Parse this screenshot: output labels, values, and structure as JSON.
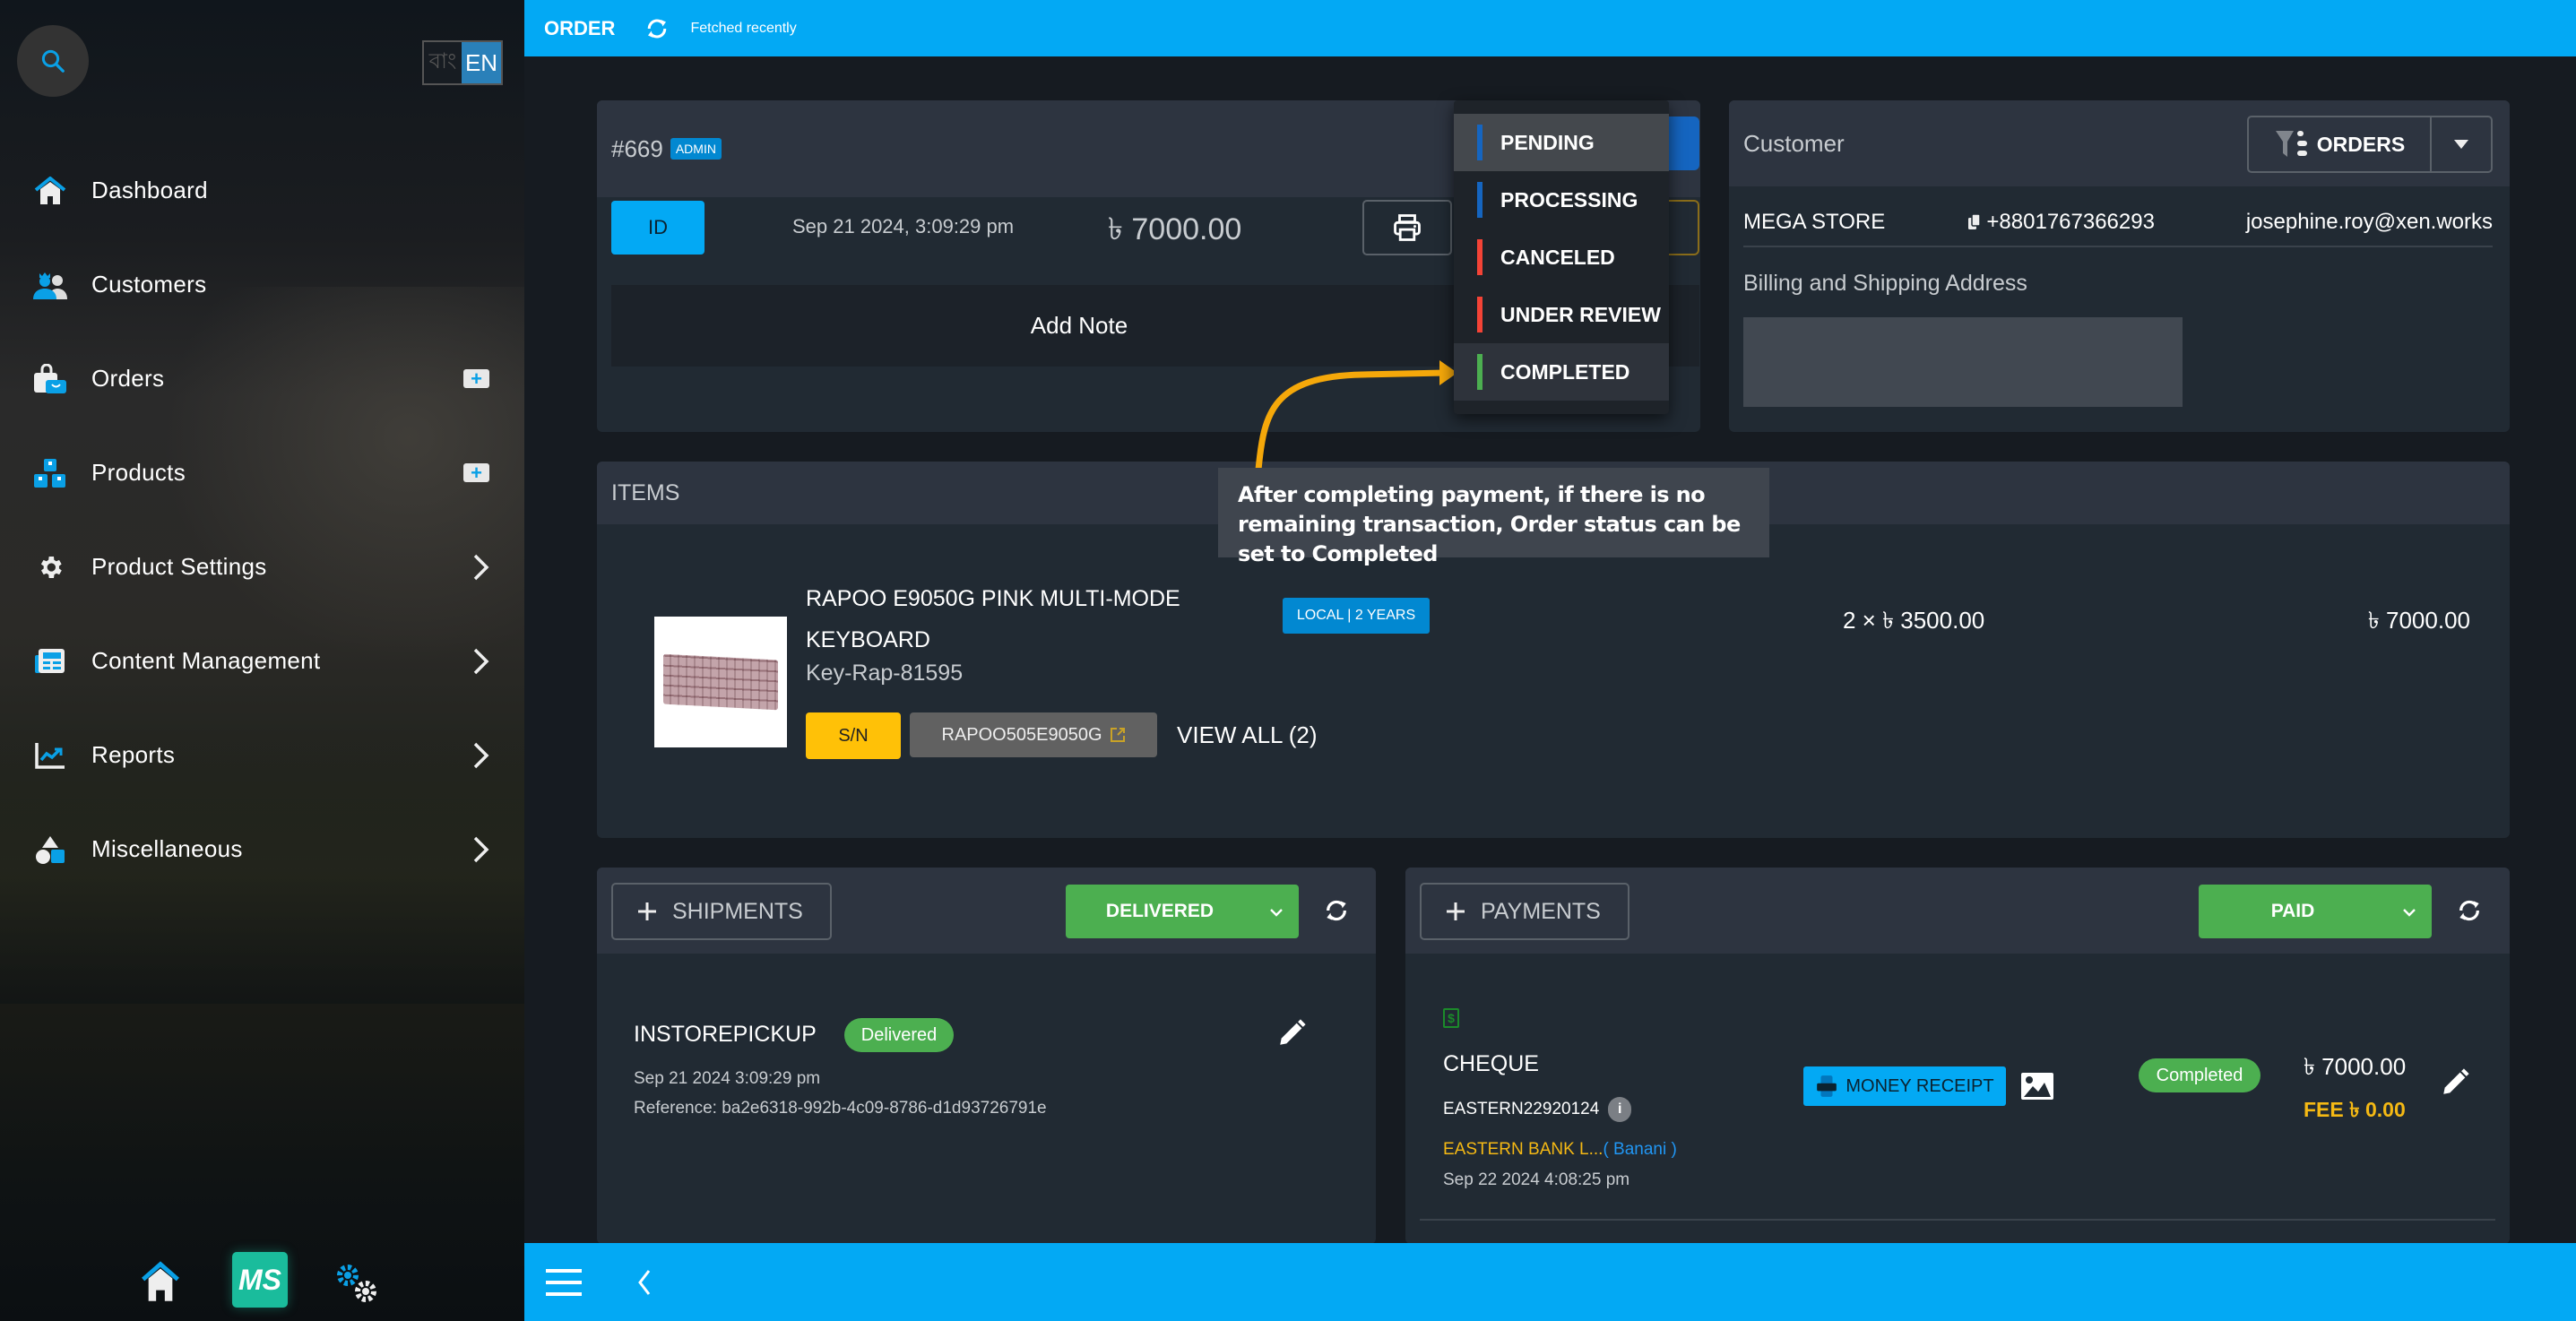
{
  "sidebar": {
    "search_icon": "search-icon",
    "language": {
      "bangla": "বাং",
      "english": "EN",
      "active": "EN"
    },
    "items": [
      {
        "label": "Dashboard",
        "icon": "home-icon",
        "action": null
      },
      {
        "label": "Customers",
        "icon": "customers-icon",
        "action": null
      },
      {
        "label": "Orders",
        "icon": "orders-bag-icon",
        "action": "add"
      },
      {
        "label": "Products",
        "icon": "products-boxes-icon",
        "action": "add"
      },
      {
        "label": "Product Settings",
        "icon": "gear-icon",
        "action": "expand"
      },
      {
        "label": "Content Management",
        "icon": "newspaper-icon",
        "action": "expand"
      },
      {
        "label": "Reports",
        "icon": "chart-line-icon",
        "action": "expand"
      },
      {
        "label": "Miscellaneous",
        "icon": "shapes-icon",
        "action": "expand"
      }
    ],
    "bottom": {
      "home": "home-icon",
      "logo_text": "MS",
      "settings": "settings-gears-icon"
    }
  },
  "topbar": {
    "title": "ORDER",
    "status": "Fetched recently"
  },
  "order": {
    "number": "#669",
    "badge": "ADMIN",
    "id_label": "ID",
    "date": "Sep 21 2024, 3:09:29 pm",
    "total": "৳ 7000.00",
    "add_note": "Add Note"
  },
  "status_menu": {
    "options": [
      {
        "label": "PENDING",
        "color": "#1565c0",
        "state": "selected"
      },
      {
        "label": "PROCESSING",
        "color": "#1565c0",
        "state": ""
      },
      {
        "label": "CANCELED",
        "color": "#f44336",
        "state": ""
      },
      {
        "label": "UNDER REVIEW",
        "color": "#f44336",
        "state": ""
      },
      {
        "label": "COMPLETED",
        "color": "#4caf50",
        "state": "hover"
      }
    ]
  },
  "customer": {
    "heading": "Customer",
    "orders_button": "ORDERS",
    "name": "MEGA STORE",
    "phone": "+8801767366293",
    "email": "josephine.roy@xen.works",
    "address_label": "Billing and Shipping Address"
  },
  "items": {
    "heading": "ITEMS",
    "rows": [
      {
        "name": "RAPOO E9050G PINK MULTI-MODE KEYBOARD",
        "sku": "Key-Rap-81595",
        "warranty": "LOCAL | 2 YEARS",
        "unit": "2 × ৳ 3500.00",
        "total": "৳ 7000.00",
        "sn_label": "S/N",
        "serial": "RAPOO505E9050G",
        "view_all": "VIEW ALL (2)"
      }
    ]
  },
  "tooltip": {
    "text": "After completing payment, if there is no remaining transaction, Order status can be set to Completed"
  },
  "shipments": {
    "add_label": "SHIPMENTS",
    "status": "DELIVERED",
    "entries": [
      {
        "method": "INSTOREPICKUP",
        "badge": "Delivered",
        "date": "Sep 21 2024 3:09:29 pm",
        "reference": "Reference: ba2e6318-992b-4c09-8786-d1d93726791e"
      }
    ]
  },
  "payments": {
    "add_label": "PAYMENTS",
    "status": "PAID",
    "entries": [
      {
        "method": "CHEQUE",
        "reference": "EASTERN22920124",
        "bank": "EASTERN BANK L...",
        "branch": "( Banani )",
        "date": "Sep 22 2024 4:08:25 pm",
        "receipt_label": "MONEY RECEIPT",
        "badge": "Completed",
        "amount": "৳ 7000.00",
        "fee": "FEE ৳ 0.00"
      }
    ]
  },
  "colors": {
    "accent": "#03a9f4",
    "success": "#4caf50",
    "warning": "#ffc107",
    "danger": "#f44336",
    "card": "#212a33"
  }
}
